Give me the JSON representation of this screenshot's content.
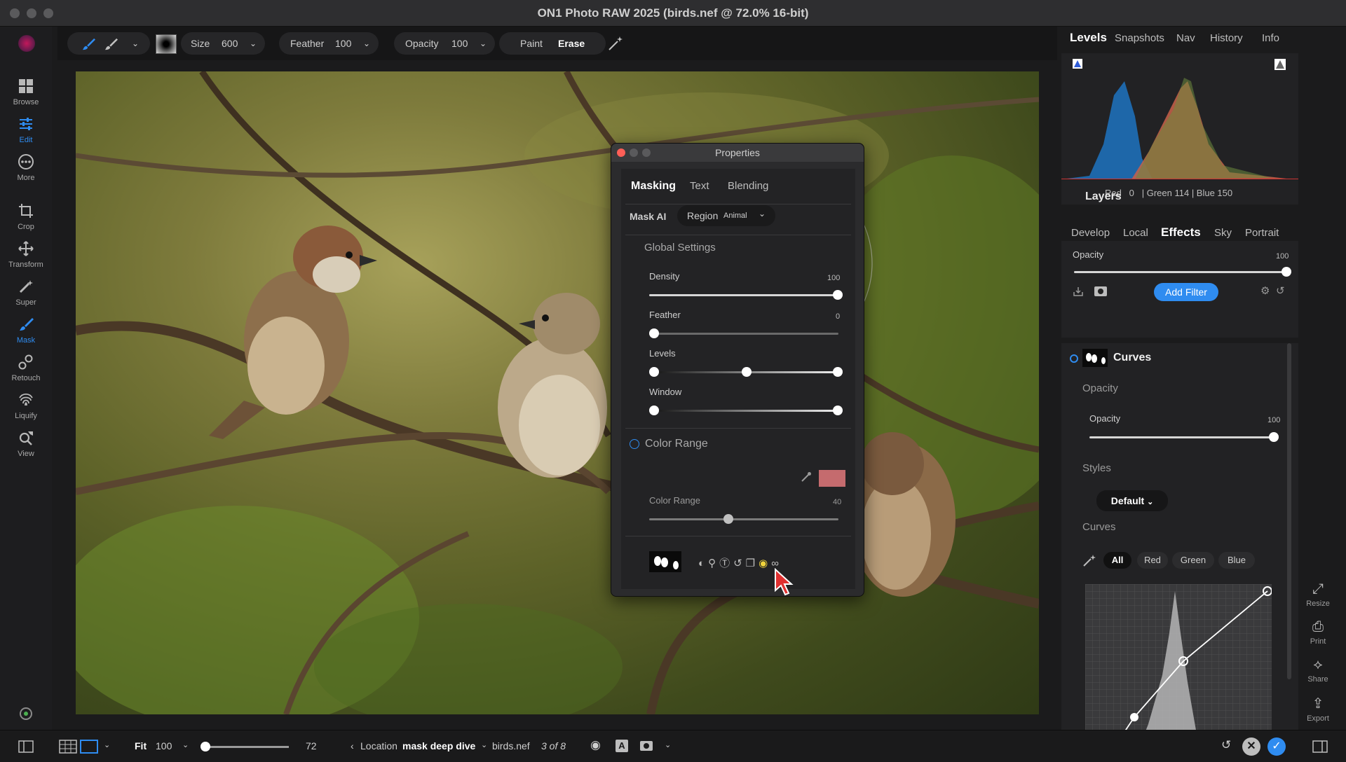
{
  "window": {
    "title": "ON1 Photo RAW 2025 (birds.nef @ 72.0% 16-bit)"
  },
  "left_tools": [
    {
      "label": "Browse",
      "icon": "grid-icon"
    },
    {
      "label": "Edit",
      "icon": "sliders-icon"
    },
    {
      "label": "More",
      "icon": "more-icon"
    },
    {
      "label": "Crop",
      "icon": "crop-icon"
    },
    {
      "label": "Transform",
      "icon": "transform-icon"
    },
    {
      "label": "Super",
      "icon": "wand-icon"
    },
    {
      "label": "Mask",
      "icon": "brush-icon"
    },
    {
      "label": "Retouch",
      "icon": "retouch-icon"
    },
    {
      "label": "Liquify",
      "icon": "fingerprint-icon"
    },
    {
      "label": "View",
      "icon": "zoom-icon"
    }
  ],
  "option_bar": {
    "size_label": "Size",
    "size_value": "600",
    "feather_label": "Feather",
    "feather_value": "100",
    "opacity_label": "Opacity",
    "opacity_value": "100",
    "paint_label": "Paint",
    "erase_label": "Erase"
  },
  "properties": {
    "title": "Properties",
    "tabs": [
      "Masking",
      "Text",
      "Blending"
    ],
    "mask_ai_label": "Mask AI",
    "region_label": "Region",
    "region_value": "Animal",
    "global_settings": "Global Settings",
    "density_label": "Density",
    "density_value": "100",
    "feather_label": "Feather",
    "feather_value": "0",
    "levels_label": "Levels",
    "window_label": "Window",
    "color_range_header": "Color Range",
    "color_range_label": "Color Range",
    "color_range_value": "40",
    "swatch_color": "#c56b6e"
  },
  "right_panel": {
    "tabs": [
      "Levels",
      "Snapshots",
      "Nav",
      "History",
      "Info"
    ],
    "histogram_readout": "Red   0   | Green 114 | Blue 150",
    "layers_title": "Layers",
    "filter_tabs": [
      "Develop",
      "Local",
      "Effects",
      "Sky",
      "Portrait"
    ],
    "opacity_label": "Opacity",
    "opacity_value": "100",
    "add_filter": "Add Filter",
    "filter_name": "Curves",
    "filter_opacity_header": "Opacity",
    "filter_opacity_label": "Opacity",
    "filter_opacity_value": "100",
    "styles_label": "Styles",
    "styles_value": "Default",
    "curves_label": "Curves",
    "curve_channels": [
      "All",
      "Red",
      "Green",
      "Blue"
    ]
  },
  "right_strip": [
    {
      "label": "Resize",
      "icon": "resize-icon"
    },
    {
      "label": "Print",
      "icon": "print-icon"
    },
    {
      "label": "Share",
      "icon": "share-icon"
    },
    {
      "label": "Export",
      "icon": "export-icon"
    }
  ],
  "bottom_bar": {
    "fit_label": "Fit",
    "fit_value": "100",
    "zoom_value": "72",
    "location_label": "Location",
    "location_value": "mask deep dive",
    "file_name": "birds.nef",
    "file_count": "3 of 8"
  },
  "colors": {
    "accent": "#2f8cf0",
    "panel": "#1b1b1c",
    "swatch": "#c56b6e"
  }
}
